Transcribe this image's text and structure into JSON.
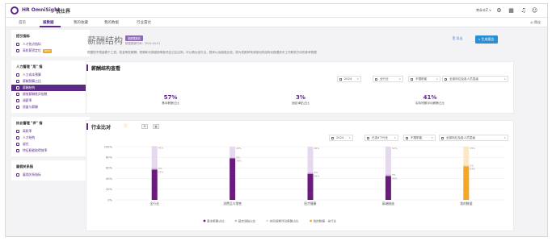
{
  "app": {
    "brand": "HR OmniSight",
    "brand_suffix": "悦仕界",
    "user": "常永丰Z ∨"
  },
  "nav": {
    "items": [
      {
        "label": "首页",
        "active": false
      },
      {
        "label": "报数据",
        "active": true
      },
      {
        "label": "我的收藏",
        "active": false
      },
      {
        "label": "我的数据",
        "active": false
      },
      {
        "label": "行业雷达",
        "active": false
      }
    ],
    "right": "◎ 简化"
  },
  "sidebar": {
    "groups": [
      {
        "title": "招引指标",
        "items": [
          {
            "label": "人才热点指标",
            "icon": "people-icon",
            "active": false
          },
          {
            "label": "高阶薪资定位",
            "icon": "trophy-icon",
            "active": false,
            "badge": "NEW"
          }
        ]
      },
      {
        "title": "人力管理 \"用\" 指",
        "items": [
          {
            "label": "人力成本预算",
            "icon": "chart-icon",
            "active": false
          },
          {
            "label": "薪酬预算占比",
            "icon": "coin-icon",
            "active": false
          },
          {
            "label": "薪酬结构",
            "icon": "structure-icon",
            "active": true
          },
          {
            "label": "绩效薪酬差异指数",
            "icon": "bar-icon",
            "active": false
          },
          {
            "label": "调薪率",
            "icon": "trend-icon",
            "active": false
          },
          {
            "label": "质量与薪酬",
            "icon": "quality-icon",
            "active": false
          }
        ]
      },
      {
        "title": "执业管理 \"评\" 指",
        "items": [
          {
            "label": "离职率",
            "icon": "exit-icon",
            "active": false
          },
          {
            "label": "人才结构",
            "icon": "org-icon",
            "active": false
          },
          {
            "label": "留任",
            "icon": "retain-icon",
            "active": false
          },
          {
            "label": "特征职能取得效率",
            "icon": "efficiency-icon",
            "active": false
          }
        ]
      },
      {
        "title": "雇佣关系指",
        "items": [
          {
            "label": "雇佣关系指标",
            "icon": "relation-icon",
            "active": false
          }
        ]
      }
    ]
  },
  "page": {
    "title": "薪酬结构",
    "tag": "报数据报告",
    "date": "数据更新时间：2024-04-01",
    "description": "根据您不限量基于工资、奖金等发薪酬、短期和长期激励等各项目占比比例，可以看出该行业、整体以及增强比较，现为您推荐有效驱动的结构化数据资讯工作薪资方向的参考数据",
    "export_label": "导出",
    "report_label": "生成报告"
  },
  "overview": {
    "title": "薪酬结构查看",
    "filters": [
      {
        "label": "2024",
        "icon": "calendar-icon"
      },
      {
        "label": "全行业",
        "icon": "industry-icon"
      },
      {
        "label": "不限职能",
        "icon": "function-icon"
      },
      {
        "label": "全部岗位及各人员层级",
        "icon": "level-icon"
      }
    ],
    "kpis": [
      {
        "value": "57%",
        "label": "基本薪酬占比"
      },
      {
        "value": "3%",
        "label": "固定津贴占比"
      },
      {
        "value": "41%",
        "label": "实际短期浮动薪酬占比"
      }
    ]
  },
  "compare": {
    "title": "行业比对",
    "toggles": [
      "M",
      "▦"
    ],
    "filters": [
      {
        "label": "2024",
        "icon": "calendar-icon"
      },
      {
        "label": "已选4个行业",
        "icon": "industry-icon"
      },
      {
        "label": "不限职能",
        "icon": "function-icon"
      },
      {
        "label": "全部岗位及各人员层级",
        "icon": "level-icon"
      }
    ]
  },
  "chart_data": {
    "type": "bar",
    "stacked": true,
    "categories": [
      "全行业",
      "消费品与零售",
      "医疗健康",
      "高端制造",
      "我的数据"
    ],
    "yticks": [
      "100%",
      "80%",
      "60%",
      "40%",
      "20%",
      "0%"
    ],
    "ylim": [
      0,
      100
    ],
    "series": [
      {
        "name": "基本薪酬占比",
        "color": "#6a1b7c",
        "values": [
          57,
          78,
          49,
          45,
          63
        ]
      },
      {
        "name": "固定津贴占比",
        "color": "#cdb7e0",
        "values": [
          3,
          2,
          3,
          3,
          2
        ]
      },
      {
        "name": "实际短期浮动薪酬占比",
        "color": "#e6d9ee",
        "values": [
          41,
          20,
          48,
          52,
          35
        ]
      }
    ],
    "mydata_colors": [
      "#f5a623",
      "#fbd28a",
      "#fde8c4"
    ],
    "value_labels": [
      [
        "57%",
        "3%",
        "41%"
      ],
      [
        "78%",
        "2%",
        "20%"
      ],
      [
        "49%",
        "3%",
        "48%"
      ],
      [
        "45%",
        "3%",
        "52%"
      ],
      [
        "63%",
        "2%",
        "35%"
      ]
    ],
    "legend": [
      {
        "name": "基本薪酬占比",
        "color": "#6a1b7c"
      },
      {
        "name": "固定津贴占比",
        "color": "#cdb7e0"
      },
      {
        "name": "实际短期浮动薪酬占比",
        "color": "#e6d9ee"
      },
      {
        "name": "我的数据 · 全行业",
        "color": "#f5a623"
      }
    ],
    "legend_position": "bottom"
  }
}
